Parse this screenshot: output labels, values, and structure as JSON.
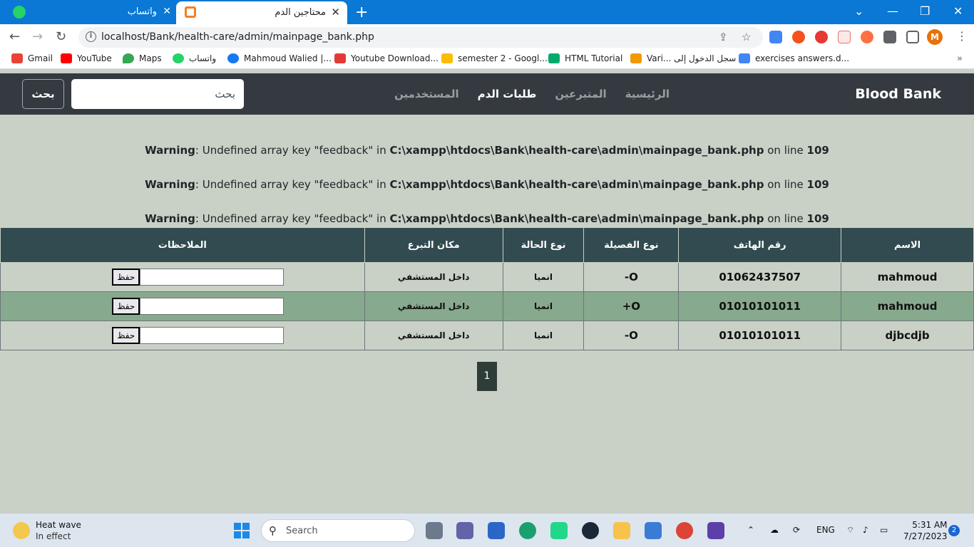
{
  "browser": {
    "tabs": [
      {
        "title": "واتساب",
        "active": false
      },
      {
        "title": "محتاجين الدم",
        "active": true
      }
    ],
    "url": "localhost/Bank/health-care/admin/mainpage_bank.php",
    "profile_initial": "M",
    "bookmarks": [
      {
        "label": "Gmail",
        "icon": "gmail-icon",
        "color": "#ea4335"
      },
      {
        "label": "YouTube",
        "icon": "youtube-icon",
        "color": "#ff0000"
      },
      {
        "label": "Maps",
        "icon": "maps-icon",
        "color": "#34a853"
      },
      {
        "label": "واتساب",
        "icon": "whatsapp-icon",
        "color": "#25d366"
      },
      {
        "label": "Mahmoud Walied |...",
        "icon": "facebook-icon",
        "color": "#1877f2"
      },
      {
        "label": "Youtube Download...",
        "icon": "download-icon",
        "color": "#e53935"
      },
      {
        "label": "semester 2 - Googl...",
        "icon": "drive-icon",
        "color": "#fbbc04"
      },
      {
        "label": "HTML Tutorial",
        "icon": "w3schools-icon",
        "color": "#04aa6d"
      },
      {
        "label": "Vari... سجل الدخول إلى",
        "icon": "sign-icon",
        "color": "#f29900"
      },
      {
        "label": "exercises answers.d...",
        "icon": "docs-icon",
        "color": "#4285f4"
      }
    ]
  },
  "navbar": {
    "brand": "Blood Bank",
    "links": [
      {
        "label": "الرئيسية",
        "active": false
      },
      {
        "label": "المتبرعين",
        "active": false
      },
      {
        "label": "طلبات الدم",
        "active": true
      },
      {
        "label": "المستخدمين",
        "active": false
      }
    ],
    "search_placeholder": "بحث",
    "search_button": "بحث"
  },
  "warnings": [
    {
      "label": "Warning",
      "message": ": Undefined array key \"feedback\" in ",
      "path": "C:\\xampp\\htdocs\\Bank\\health-care\\admin\\mainpage_bank.php",
      "on_line": " on line ",
      "line": "109"
    },
    {
      "label": "Warning",
      "message": ": Undefined array key \"feedback\" in ",
      "path": "C:\\xampp\\htdocs\\Bank\\health-care\\admin\\mainpage_bank.php",
      "on_line": " on line ",
      "line": "109"
    },
    {
      "label": "Warning",
      "message": ": Undefined array key \"feedback\" in ",
      "path": "C:\\xampp\\htdocs\\Bank\\health-care\\admin\\mainpage_bank.php",
      "on_line": " on line ",
      "line": "109"
    }
  ],
  "table": {
    "headers": [
      "الاسم",
      "رقم الهاتف",
      "نوع الفصيلة",
      "نوع الحالة",
      "مكان التبرع",
      "الملاحظات"
    ],
    "rows": [
      {
        "name": "mahmoud",
        "phone": "01062437507",
        "blood": "O-",
        "state": "انميا",
        "place": "داخل المستشفي",
        "save": "حفظ"
      },
      {
        "name": "mahmoud",
        "phone": "01010101011",
        "blood": "O+",
        "state": "انميا",
        "place": "داخل المستشفي",
        "save": "حفظ"
      },
      {
        "name": "djbcdjb",
        "phone": "01010101011",
        "blood": "O-",
        "state": "انميا",
        "place": "داخل المستشفي",
        "save": "حفظ"
      }
    ]
  },
  "pagination": {
    "current": "1"
  },
  "taskbar": {
    "weather_title": "Heat wave",
    "weather_sub": "In effect",
    "search_placeholder": "Search",
    "language": "ENG",
    "time": "5:31 AM",
    "date": "7/27/2023",
    "notifications": "2"
  }
}
